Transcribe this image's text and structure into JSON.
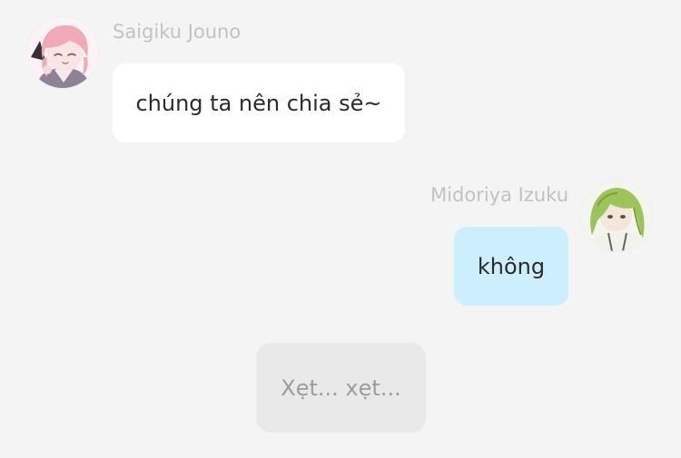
{
  "messages": [
    {
      "sender": "Saigiku Jouno",
      "text": "chúng ta nên chia sẻ~",
      "side": "left",
      "avatar": "pink-haired-character-avatar"
    },
    {
      "sender": "Midoriya Izuku",
      "text": "không",
      "side": "right",
      "avatar": "green-haired-character-avatar"
    }
  ],
  "status_message": {
    "text": "Xẹt... xẹt..."
  },
  "colors": {
    "background": "#f4f4f4",
    "incoming_bubble": "#ffffff",
    "outgoing_bubble": "#cdeefd",
    "status_bubble": "#e9e9e9",
    "sender_name": "#c2c2c2",
    "status_text": "#9c9c9c"
  }
}
